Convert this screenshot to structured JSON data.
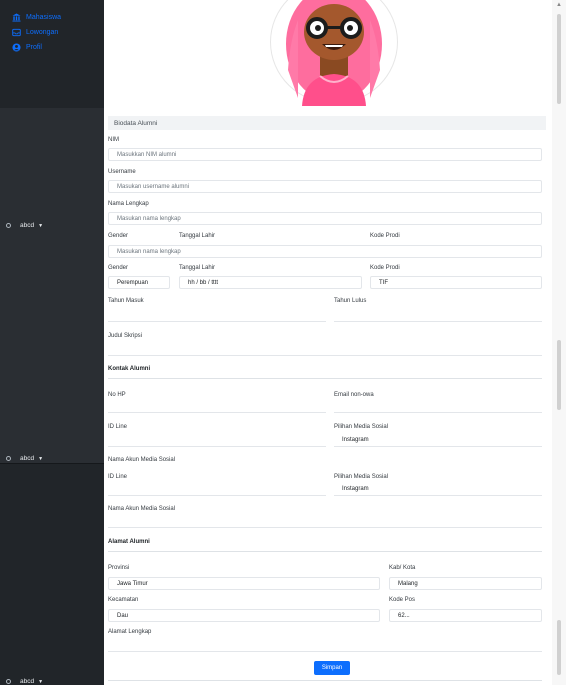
{
  "sidebar": {
    "items": [
      {
        "label": "Mahasiswa",
        "icon": "bank-icon"
      },
      {
        "label": "Lowongan",
        "icon": "inbox-icon"
      },
      {
        "label": "Profil",
        "icon": "person-circle-icon"
      }
    ],
    "user_label": "abcd",
    "accent": "#0d6efd"
  },
  "form": {
    "biodata_title": "Biodata Alumni",
    "nim_label": "NIM",
    "nim_placeholder": "Masukkan NIM alumni",
    "username_label": "Username",
    "username_placeholder": "Masukan username alumni",
    "nama_label": "Nama Lengkap",
    "nama_placeholder": "Masukan nama lengkap",
    "gender_label": "Gender",
    "tgl_label": "Tanggal Lahir",
    "prodi_label": "Kode Prodi",
    "nama_placeholder_2": "Masukan nama lengkap",
    "gender_value": "Perempuan",
    "tgl_value": "hh / bb / tttt",
    "prodi_value": "TIF",
    "tahun_masuk_label": "Tahun Masuk",
    "tahun_lulus_label": "Tahun Lulus",
    "skripsi_label": "Judul Skripsi",
    "kontak_title": "Kontak Alumni",
    "nohp_label": "No HP",
    "email_label": "Email non-owa",
    "idline_label": "ID Line",
    "media_label": "Pilihan Media Sosial",
    "media_value": "Instagram",
    "akun_label": "Nama Akun Media Sosial",
    "idline_label_2": "ID Line",
    "media_label_2": "Pilihan Media Sosial",
    "media_value_2": "Instagram",
    "akun_label_2": "Nama Akun Media Sosial",
    "alamat_title": "Alamat Alumni",
    "provinsi_label": "Provinsi",
    "provinsi_value": "Jawa Timur",
    "kota_label": "Kab/ Kota",
    "kota_value": "Malang",
    "kecamatan_label": "Kecamatan",
    "kecamatan_value": "Dau",
    "kodepos_label": "Kode Pos",
    "kodepos_value": "62...",
    "alamat_label": "Alamat Lengkap",
    "submit_label": "Simpan"
  }
}
